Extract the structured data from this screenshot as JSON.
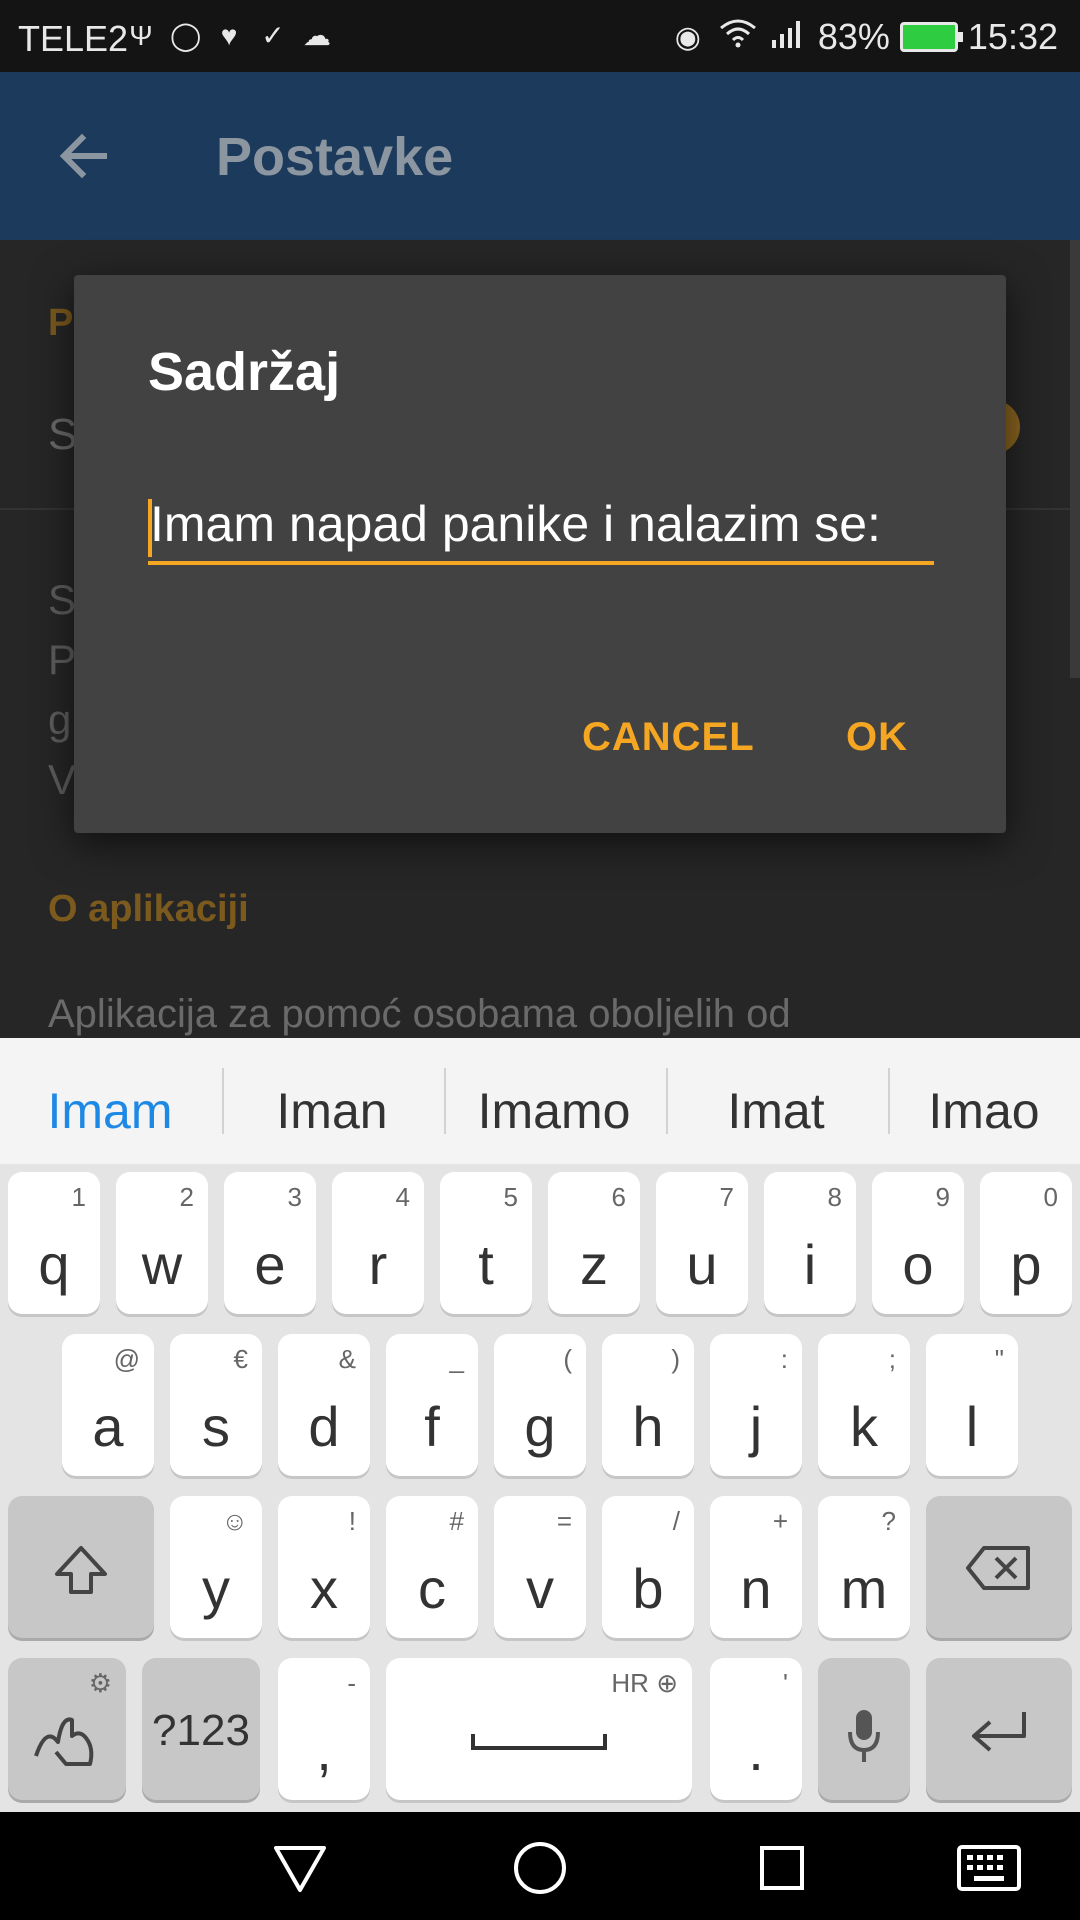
{
  "status_bar": {
    "carrier": "TELE2",
    "left_icons": [
      "usb-icon",
      "watch-icon",
      "heart-rate-icon",
      "check-flag-icon",
      "cloud-icon"
    ],
    "right_icons": [
      "eye-icon",
      "wifi-icon",
      "signal-icon"
    ],
    "battery_percent": "83%",
    "time": "15:32"
  },
  "app_bar": {
    "title": "Postavke"
  },
  "background": {
    "section1_initial": "P",
    "row1_initial": "S",
    "letters": [
      "S",
      "P",
      "g",
      "V"
    ],
    "section2_title": "O aplikaciji",
    "description": "Aplikacija za pomoć osobama oboljelih od"
  },
  "dialog": {
    "title": "Sadržaj",
    "input_value": "Imam napad panike i nalazim se:",
    "cancel_label": "CANCEL",
    "ok_label": "OK"
  },
  "keyboard": {
    "suggestions": [
      "Imam",
      "Iman",
      "Imamo",
      "Imat",
      "Imao"
    ],
    "row1": [
      {
        "k": "q",
        "a": "1"
      },
      {
        "k": "w",
        "a": "2"
      },
      {
        "k": "e",
        "a": "3"
      },
      {
        "k": "r",
        "a": "4"
      },
      {
        "k": "t",
        "a": "5"
      },
      {
        "k": "z",
        "a": "6"
      },
      {
        "k": "u",
        "a": "7"
      },
      {
        "k": "i",
        "a": "8"
      },
      {
        "k": "o",
        "a": "9"
      },
      {
        "k": "p",
        "a": "0"
      }
    ],
    "row2": [
      {
        "k": "a",
        "a": "@"
      },
      {
        "k": "s",
        "a": "€"
      },
      {
        "k": "d",
        "a": "&"
      },
      {
        "k": "f",
        "a": "_"
      },
      {
        "k": "g",
        "a": "("
      },
      {
        "k": "h",
        "a": ")"
      },
      {
        "k": "j",
        "a": ":"
      },
      {
        "k": "k",
        "a": ";"
      },
      {
        "k": "l",
        "a": "\""
      }
    ],
    "row3": [
      {
        "k": "y",
        "a": "☺"
      },
      {
        "k": "x",
        "a": "!"
      },
      {
        "k": "c",
        "a": "#"
      },
      {
        "k": "v",
        "a": "="
      },
      {
        "k": "b",
        "a": "/"
      },
      {
        "k": "n",
        "a": "+"
      },
      {
        "k": "m",
        "a": "?"
      }
    ],
    "symbols_label": "?123",
    "comma": {
      "k": ",",
      "a": "-"
    },
    "space_lang": "HR",
    "period": {
      "k": ".",
      "a": "'"
    }
  }
}
